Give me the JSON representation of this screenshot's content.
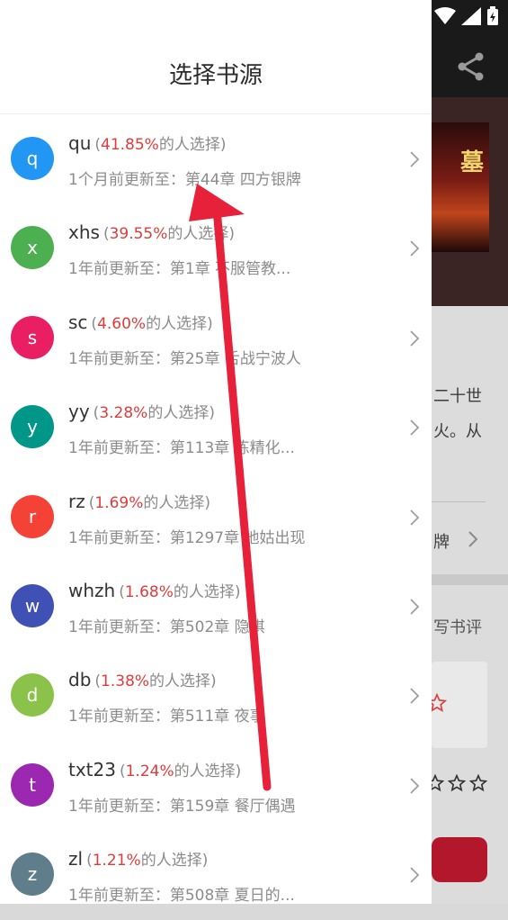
{
  "drawer": {
    "title": "选择书源",
    "choose_suffix": "的人选择",
    "update_prefix": "前更新至：",
    "items": [
      {
        "letter": "q",
        "name": "qu",
        "percent": "41.85%",
        "color": "#2196f3",
        "updated": "1个月",
        "chapter": "第44章 四方银牌"
      },
      {
        "letter": "x",
        "name": "xhs",
        "percent": "39.55%",
        "color": "#4caf50",
        "updated": "1年",
        "chapter": "第1章 不服管教..."
      },
      {
        "letter": "s",
        "name": "sc",
        "percent": "4.60%",
        "color": "#e91e63",
        "updated": "1年",
        "chapter": "第25章 舌战宁波人"
      },
      {
        "letter": "y",
        "name": "yy",
        "percent": "3.28%",
        "color": "#009688",
        "updated": "1年",
        "chapter": "第113章 炼精化..."
      },
      {
        "letter": "r",
        "name": "rz",
        "percent": "1.69%",
        "color": "#f44336",
        "updated": "1年",
        "chapter": "第1297章 地姑出现"
      },
      {
        "letter": "w",
        "name": "whzh",
        "percent": "1.68%",
        "color": "#3f51b5",
        "updated": "1年",
        "chapter": "第502章 隐棋"
      },
      {
        "letter": "d",
        "name": "db",
        "percent": "1.38%",
        "color": "#8bc34a",
        "updated": "1年",
        "chapter": "第511章 夜事"
      },
      {
        "letter": "t",
        "name": "txt23",
        "percent": "1.24%",
        "color": "#9c27b0",
        "updated": "1年",
        "chapter": "第159章 餐厅偶遇"
      },
      {
        "letter": "z",
        "name": "zl",
        "percent": "1.21%",
        "color": "#607d8b",
        "updated": "1年",
        "chapter": "第508章 夏日的..."
      }
    ]
  },
  "background": {
    "cover_title": "墓",
    "desc_line1": "二十世",
    "desc_line2": "火。从",
    "row_label": "牌",
    "review_label": "写书评"
  },
  "colors": {
    "accent_red": "#e23a3a",
    "arrow": "#e8213a"
  }
}
